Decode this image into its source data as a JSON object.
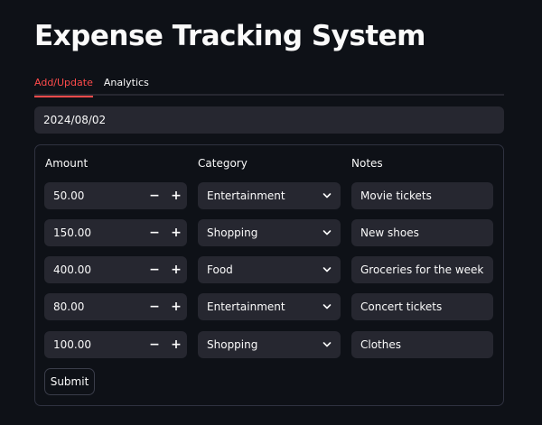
{
  "title": "Expense Tracking System",
  "tabs": [
    {
      "label": "Add/Update",
      "active": true
    },
    {
      "label": "Analytics",
      "active": false
    }
  ],
  "date": "2024/08/02",
  "columns": {
    "amount": "Amount",
    "category": "Category",
    "notes": "Notes"
  },
  "rows": [
    {
      "amount": "50.00",
      "category": "Entertainment",
      "notes": "Movie tickets"
    },
    {
      "amount": "150.00",
      "category": "Shopping",
      "notes": "New shoes"
    },
    {
      "amount": "400.00",
      "category": "Food",
      "notes": "Groceries for the week"
    },
    {
      "amount": "80.00",
      "category": "Entertainment",
      "notes": "Concert tickets"
    },
    {
      "amount": "100.00",
      "category": "Shopping",
      "notes": "Clothes"
    }
  ],
  "stepper": {
    "minus": "−",
    "plus": "+"
  },
  "submit_label": "Submit",
  "colors": {
    "accent": "#ff4b4b",
    "background": "#0e1117",
    "input": "#262730"
  }
}
